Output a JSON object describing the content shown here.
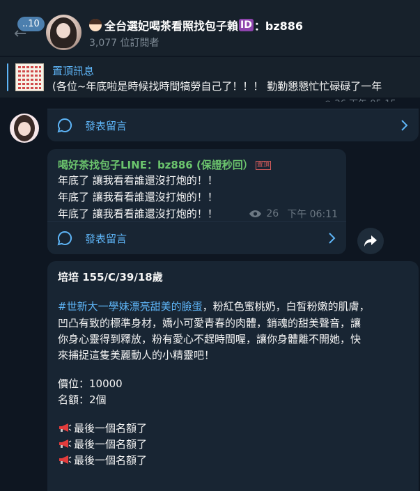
{
  "header": {
    "unread_count": "..10",
    "channel_title": "全台選妃喝茶看照找包子賴",
    "channel_title_suffix": "：bz886",
    "id_badge": "ID",
    "subscribers": "3,077 位訂閱者"
  },
  "pinned": {
    "label": "置頂訊息",
    "text": "(各位~年底啦是時候找時間犒勞自己了！！！ 勤勤懇懇忙忙碌碌了一年"
  },
  "comments": {
    "label": "發表留言"
  },
  "message2": {
    "header": "喝好茶找包子LINE：bz886 (保證秒回）",
    "pin_tag": "置頂",
    "lines": [
      "年底了 讓我看看誰還沒打炮的！！",
      "年底了 讓我看看誰還沒打炮的！！",
      "年底了 讓我看看誰還沒打炮的！！"
    ],
    "views": "26",
    "time": "下午 06:11"
  },
  "message3": {
    "heading": "培培 155/C/39/18歲",
    "hashtag": "#世新大一學妹漂亮甜美的臉蛋",
    "desc_line1_rest": "，粉紅色蜜桃奶，白皙粉嫩的肌膚，",
    "desc_line2": "凹凸有致的標準身材，嬌小可愛青春的肉體，銷魂的甜美聲音，讓",
    "desc_line3": "你身心靈得到釋放，粉有愛心不趕時間喔，讓你身體離不開她，快",
    "desc_line4": "來捕捉這隻美麗動人的小精靈吧！",
    "price": "價位：10000",
    "quota": "名額：2個",
    "last_spots": [
      "最後一個名額了",
      "最後一個名額了",
      "最後一個名額了"
    ]
  },
  "colors": {
    "accent": "#5eb5f7",
    "green_name": "#6bc46d",
    "bubble": "#182533",
    "background": "#0e1621"
  },
  "icons": [
    "back-arrow-icon",
    "comment-bubble-icon",
    "chevron-right-icon",
    "eye-icon",
    "share-icon",
    "megaphone-icon"
  ]
}
